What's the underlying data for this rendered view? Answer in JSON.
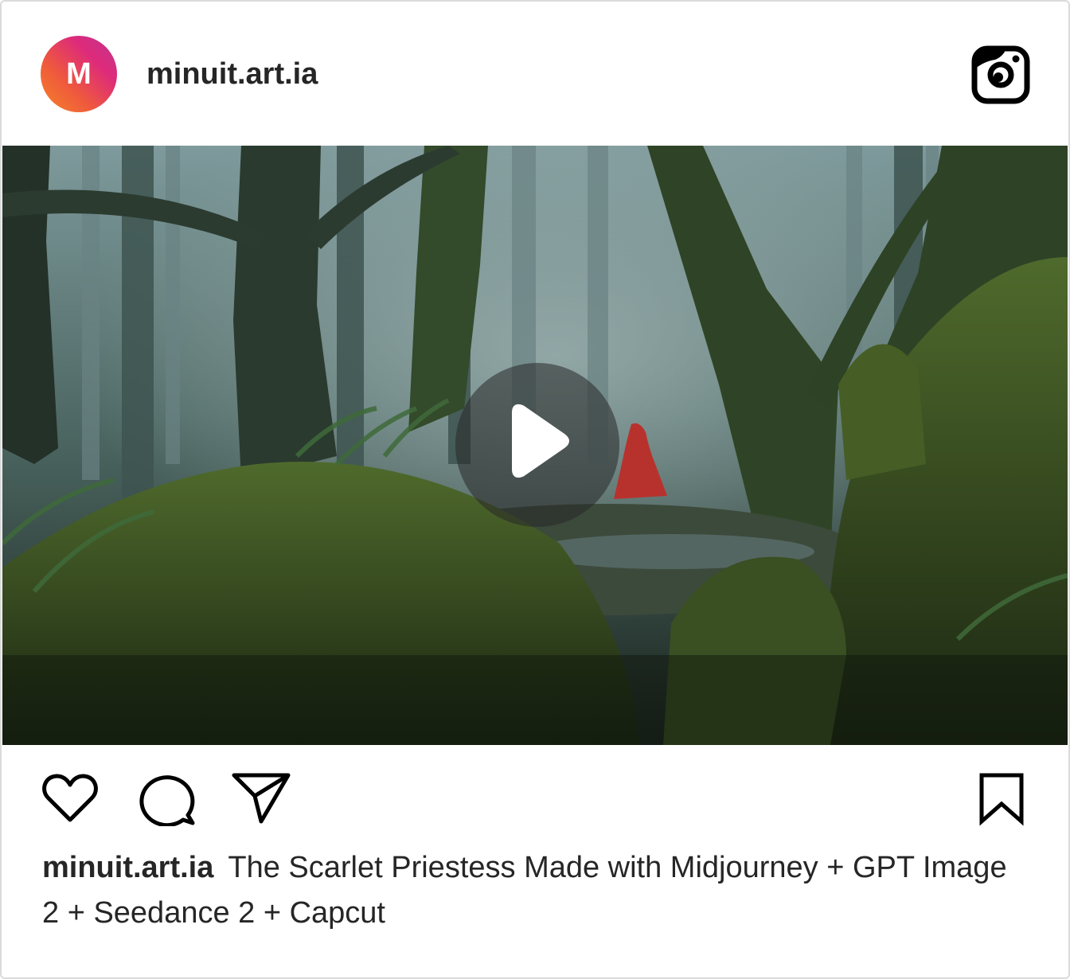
{
  "post": {
    "avatar_initial": "M",
    "username": "minuit.art.ia",
    "caption_user": "minuit.art.ia",
    "caption_text": "The Scarlet Priestess Made with Midjourney + GPT Image 2 + Seedance 2 + Capcut"
  },
  "colors": {
    "text": "#262626",
    "border": "#dbdbdb",
    "cloak_red": "#b8322d"
  },
  "icons": {
    "brand": "instagram-logo-icon",
    "play": "play-icon",
    "like": "heart-icon",
    "comment": "comment-bubble-icon",
    "share": "paper-plane-icon",
    "save": "bookmark-icon"
  }
}
